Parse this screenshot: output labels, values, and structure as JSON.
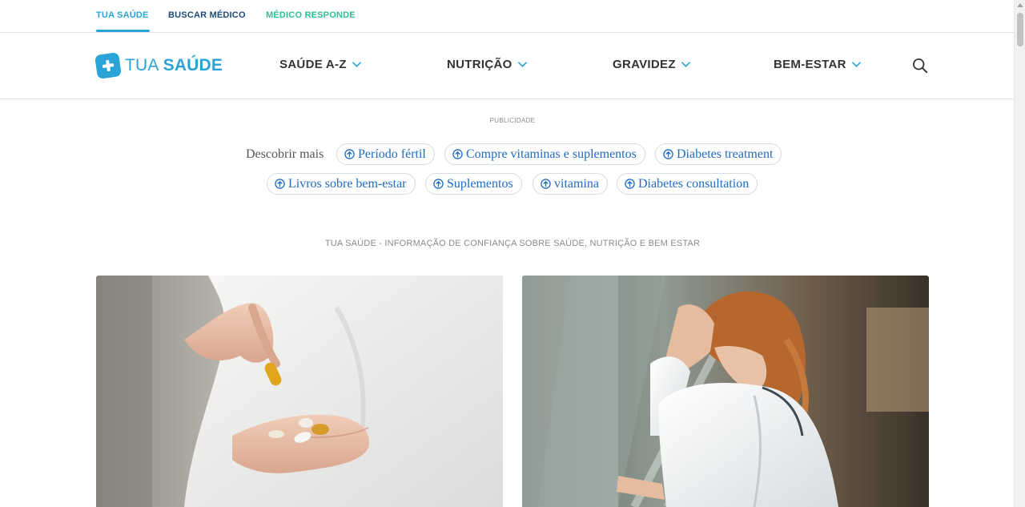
{
  "top_tabs": {
    "tua_saude": "TUA SAÚDE",
    "buscar_medico": "BUSCAR MÉDICO",
    "medico_responde": "MÉDICO RESPONDE",
    "active": "TUA SAÚDE"
  },
  "logo": {
    "word1": "TUA",
    "word2": "SAÚDE"
  },
  "nav": {
    "items": [
      {
        "label": "SAÚDE A-Z",
        "icon": "chevron-down-icon"
      },
      {
        "label": "NUTRIÇÃO",
        "icon": "chevron-down-icon"
      },
      {
        "label": "GRAVIDEZ",
        "icon": "chevron-down-icon"
      },
      {
        "label": "BEM-ESTAR",
        "icon": "chevron-down-icon"
      }
    ],
    "search_icon": "search-icon"
  },
  "ad": {
    "label": "PUBLICIDADE",
    "discover_label": "Descobrir mais",
    "chips": [
      "Período fértil",
      "Compre vitaminas e suplementos",
      "Diabetes treatment",
      "Livros sobre bem-estar",
      "Suplementos",
      "vitamina",
      "Diabetes consultation"
    ]
  },
  "tagline": "TUA SAÚDE - INFORMAÇÃO DE CONFIANÇA SOBRE SAÚDE, NUTRIÇÃO E BEM ESTAR",
  "colors": {
    "brand": "#2aa4d6",
    "dark_blue": "#1d4a78",
    "green": "#2bbf93",
    "chip_text": "#1e6bc4"
  }
}
